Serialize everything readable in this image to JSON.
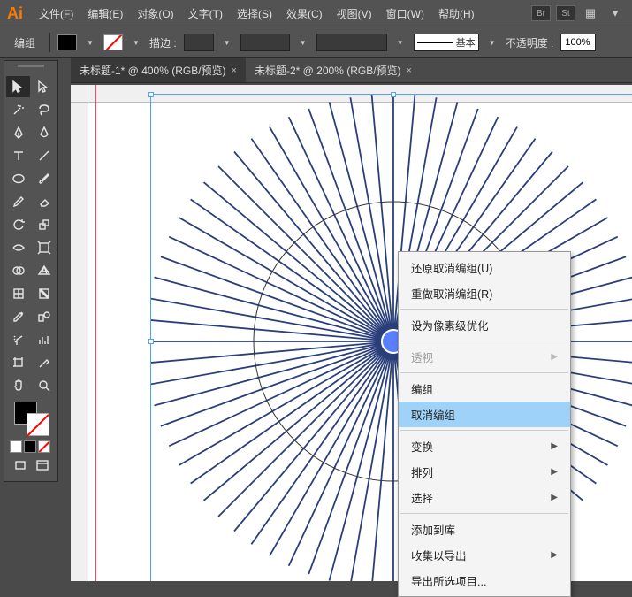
{
  "app": {
    "logo": "Ai"
  },
  "menu": {
    "file": "文件(F)",
    "edit": "编辑(E)",
    "object": "对象(O)",
    "text": "文字(T)",
    "select": "选择(S)",
    "effect": "效果(C)",
    "view": "视图(V)",
    "window": "窗口(W)",
    "help": "帮助(H)"
  },
  "badges": {
    "br": "Br",
    "st": "St"
  },
  "options": {
    "mode": "编组",
    "stroke_label": "描边 :",
    "opacity_label": "不透明度 :",
    "opacity_value": "100%",
    "basic": "基本"
  },
  "tabs": [
    {
      "title": "未标题-1* @ 400% (RGB/预览)",
      "active": false
    },
    {
      "title": "未标题-2* @ 200% (RGB/预览)",
      "active": true
    }
  ],
  "context_menu": {
    "undo": "还原取消编组(U)",
    "redo": "重做取消编组(R)",
    "pixel": "设为像素级优化",
    "perspective": "透视",
    "group": "编组",
    "ungroup": "取消编组",
    "transform": "变换",
    "arrange": "排列",
    "select_sub": "选择",
    "addlib": "添加到库",
    "collect": "收集以导出",
    "export": "导出所选项目..."
  },
  "tool_names": {
    "selection": "selection-tool",
    "direct": "direct-selection-tool",
    "wand": "magic-wand-tool",
    "lasso": "lasso-tool",
    "pen": "pen-tool",
    "curvature": "curvature-tool",
    "type": "type-tool",
    "line": "line-tool",
    "ellipse": "ellipse-tool",
    "brush": "brush-tool",
    "pencil": "pencil-tool",
    "eraser": "eraser-tool",
    "rotate": "rotate-tool",
    "scale": "scale-tool",
    "width": "width-tool",
    "free": "free-transform-tool",
    "shape-builder": "shape-builder-tool",
    "perspective": "perspective-grid-tool",
    "mesh": "mesh-tool",
    "gradient": "gradient-tool",
    "eyedropper": "eyedropper-tool",
    "blend": "blend-tool",
    "symbol": "symbol-sprayer-tool",
    "graph": "column-graph-tool",
    "artboard": "artboard-tool",
    "slice": "slice-tool",
    "hand": "hand-tool",
    "zoom": "zoom-tool"
  }
}
